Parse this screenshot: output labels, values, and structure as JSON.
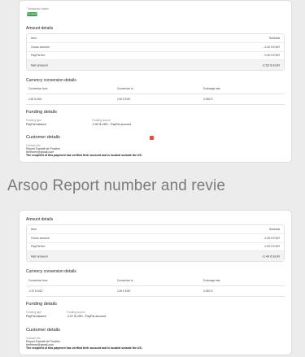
{
  "card1": {
    "txn_label": "Transaction status",
    "txn_status": "Completed",
    "amount_title": "Amount details",
    "amount_header": {
      "item": "Item",
      "subtotal": "Subtotal"
    },
    "amount_rows": [
      {
        "item": "Gross amount",
        "value": "-2.52 € EUR"
      },
      {
        "item": "PayPal fee",
        "value": "0.00 € EUR"
      }
    ],
    "net": {
      "item": "Net amount",
      "value": "-2.52 € EUR"
    },
    "currency_title": "Currency conversion details",
    "currency_header": {
      "from": "Conversion from",
      "to": "Conversion to",
      "rate": "Exchange rate"
    },
    "currency_row": {
      "from": "2.69 $ USD",
      "to": "2.52 € EUR",
      "rate": "0.93673"
    },
    "funding_title": "Funding details",
    "funding_type_label": "Funding type",
    "funding_type_value": "PayPal balance",
    "funding_source_label": "Funding source",
    "funding_source_value": "-2.69 $ USD - PayPal account",
    "customer_title": "Customer details",
    "contact_label": "Contact info",
    "contact_name": "Report Gambit de Prudhin",
    "contact_email": "thefirmer@gmail.com",
    "verified_note": "The recipient of this payment has verified their account and is located outside the US."
  },
  "heading": "Arsoo   Report number and revie",
  "card2": {
    "amount_title": "Amount details",
    "amount_header": {
      "item": "Item",
      "subtotal": "Subtotal"
    },
    "amount_rows": [
      {
        "item": "Gross amount",
        "value": "-2.49 € EUR"
      },
      {
        "item": "PayPal fee",
        "value": "0.00 € EUR"
      }
    ],
    "net": {
      "item": "Net amount",
      "value": "-2.49 € EUR"
    },
    "currency_title": "Currency conversion details",
    "currency_header": {
      "from": "Conversion from",
      "to": "Conversion to",
      "rate": "Exchange rate"
    },
    "currency_row": {
      "from": "-2.67 $ USD",
      "to": "2.49 € EUR",
      "rate": "0.93073"
    },
    "funding_title": "Funding details",
    "funding_type_label": "Funding type",
    "funding_type_value": "PayPal balance",
    "funding_source_label": "Funding source",
    "funding_source_value": "-2.67 $ USD - PayPal account",
    "customer_title": "Customer details",
    "contact_label": "Contact info",
    "contact_name": "Report Gambit de Prudhin",
    "contact_email": "thefirmer@gmail.com",
    "verified_note": "The recipient of this payment has verified their account and is located outside the US."
  },
  "colors": {
    "status_green": "#3e9c4b",
    "alert_red": "#e2503c",
    "page_bg": "#ececec"
  },
  "icons": {
    "alert": "alert-icon"
  }
}
